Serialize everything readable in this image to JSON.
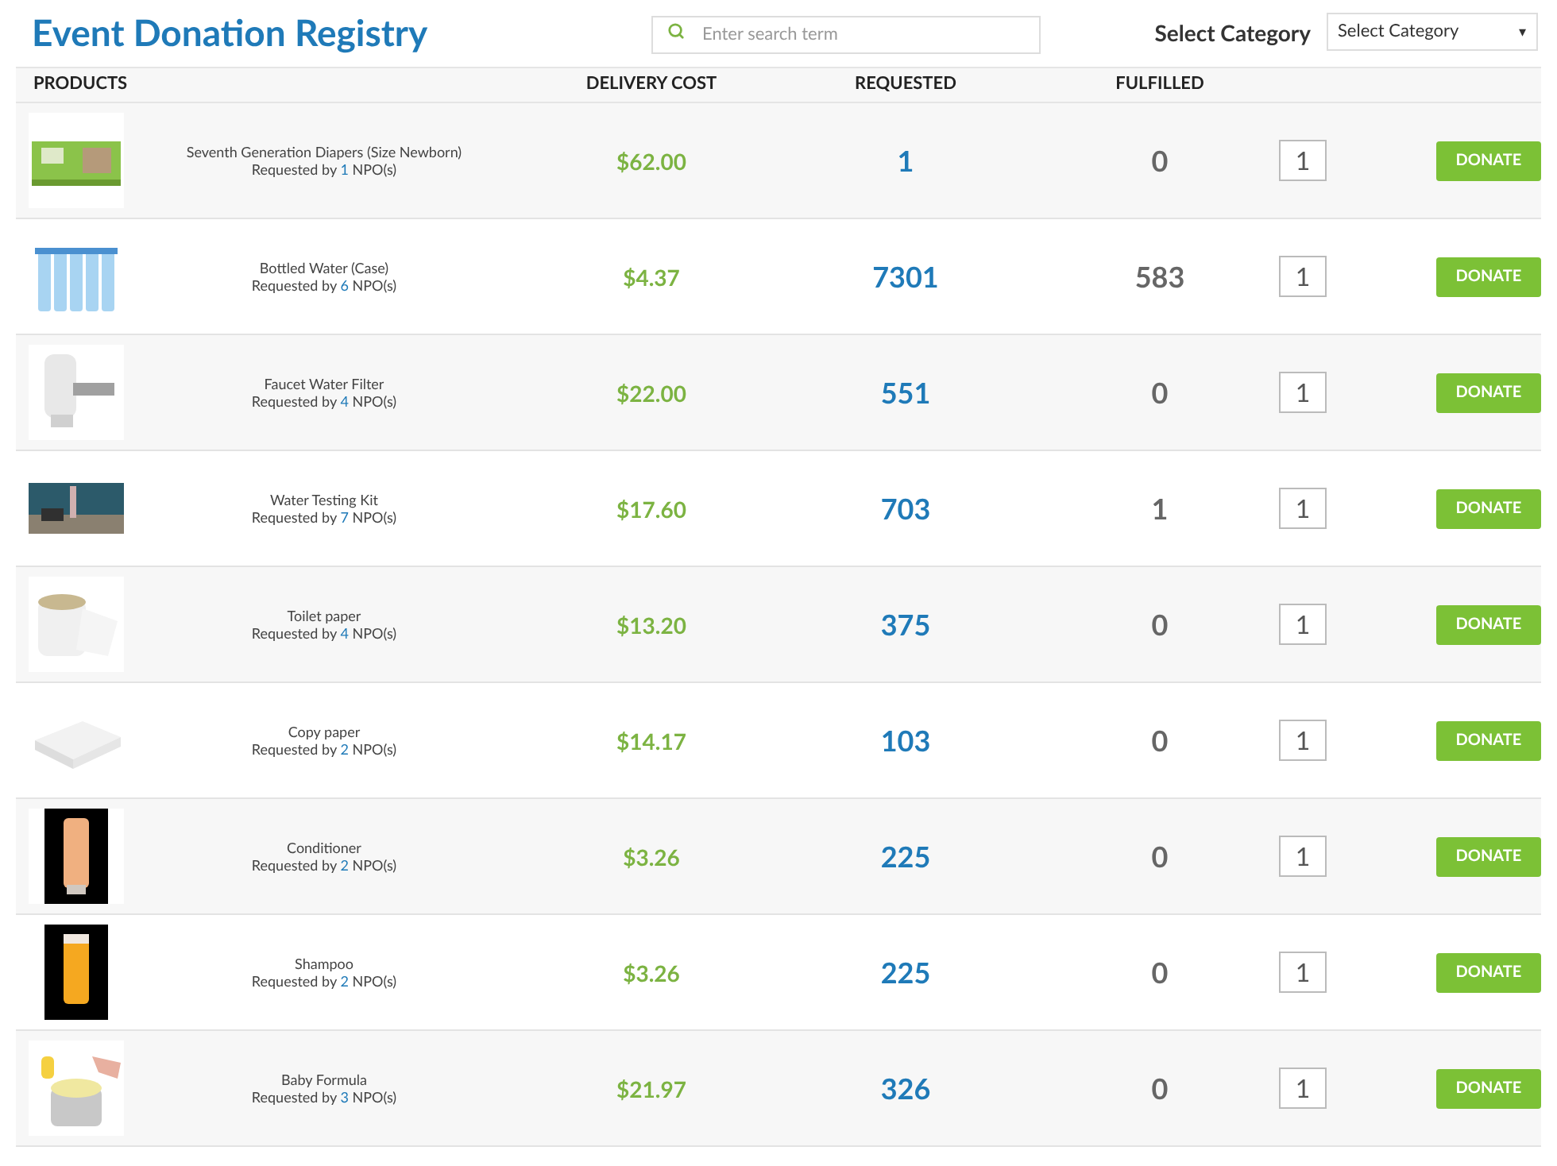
{
  "title": "Event Donation Registry",
  "search": {
    "placeholder": "Enter search term"
  },
  "category": {
    "label": "Select Category",
    "value": "Select Category",
    "arrow": "▾"
  },
  "table": {
    "columns": [
      "PRODUCTS",
      "DELIVERY COST",
      "REQUESTED",
      "FULFILLED"
    ],
    "rows": [
      {
        "kind": "picture",
        "name": "Seventh Generation Diapers (Size Newborn)",
        "requested_by": "Requested by",
        "npo_count": "1",
        "npo_suffix": "NPO(s)",
        "cost": "$62.00",
        "requested": "1",
        "fulfilled": "0",
        "quantity": "1",
        "action": "DONATE"
      },
      {
        "kind": "picture",
        "name": "Bottled Water (Case)",
        "requested_by": "Requested by",
        "npo_count": "6",
        "npo_suffix": "NPO(s)",
        "cost": "$4.37",
        "requested": "7301",
        "fulfilled": "583",
        "quantity": "1",
        "action": "DONATE"
      },
      {
        "kind": "picture",
        "name": "Faucet Water Filter",
        "requested_by": "Requested by",
        "npo_count": "4",
        "npo_suffix": "NPO(s)",
        "cost": "$22.00",
        "requested": "551",
        "fulfilled": "0",
        "quantity": "1",
        "action": "DONATE"
      },
      {
        "kind": "picture",
        "name": "Water Testing Kit",
        "requested_by": "Requested by",
        "npo_count": "7",
        "npo_suffix": "NPO(s)",
        "cost": "$17.60",
        "requested": "703",
        "fulfilled": "1",
        "quantity": "1",
        "action": "DONATE"
      },
      {
        "kind": "picture",
        "name": "Toilet paper",
        "requested_by": "Requested by",
        "npo_count": "4",
        "npo_suffix": "NPO(s)",
        "cost": "$13.20",
        "requested": "375",
        "fulfilled": "0",
        "quantity": "1",
        "action": "DONATE"
      },
      {
        "kind": "picture",
        "name": "Copy paper",
        "requested_by": "Requested by",
        "npo_count": "2",
        "npo_suffix": "NPO(s)",
        "cost": "$14.17",
        "requested": "103",
        "fulfilled": "0",
        "quantity": "1",
        "action": "DONATE"
      },
      {
        "kind": "picture",
        "name": "Conditioner",
        "requested_by": "Requested by",
        "npo_count": "2",
        "npo_suffix": "NPO(s)",
        "cost": "$3.26",
        "requested": "225",
        "fulfilled": "0",
        "quantity": "1",
        "action": "DONATE"
      },
      {
        "kind": "picture",
        "name": "Shampoo",
        "requested_by": "Requested by",
        "npo_count": "2",
        "npo_suffix": "NPO(s)",
        "cost": "$3.26",
        "requested": "225",
        "fulfilled": "0",
        "quantity": "1",
        "action": "DONATE"
      },
      {
        "kind": "picture",
        "name": "Baby Formula",
        "requested_by": "Requested by",
        "npo_count": "3",
        "npo_suffix": "NPO(s)",
        "cost": "$21.97",
        "requested": "326",
        "fulfilled": "0",
        "quantity": "1",
        "action": "DONATE"
      }
    ]
  }
}
